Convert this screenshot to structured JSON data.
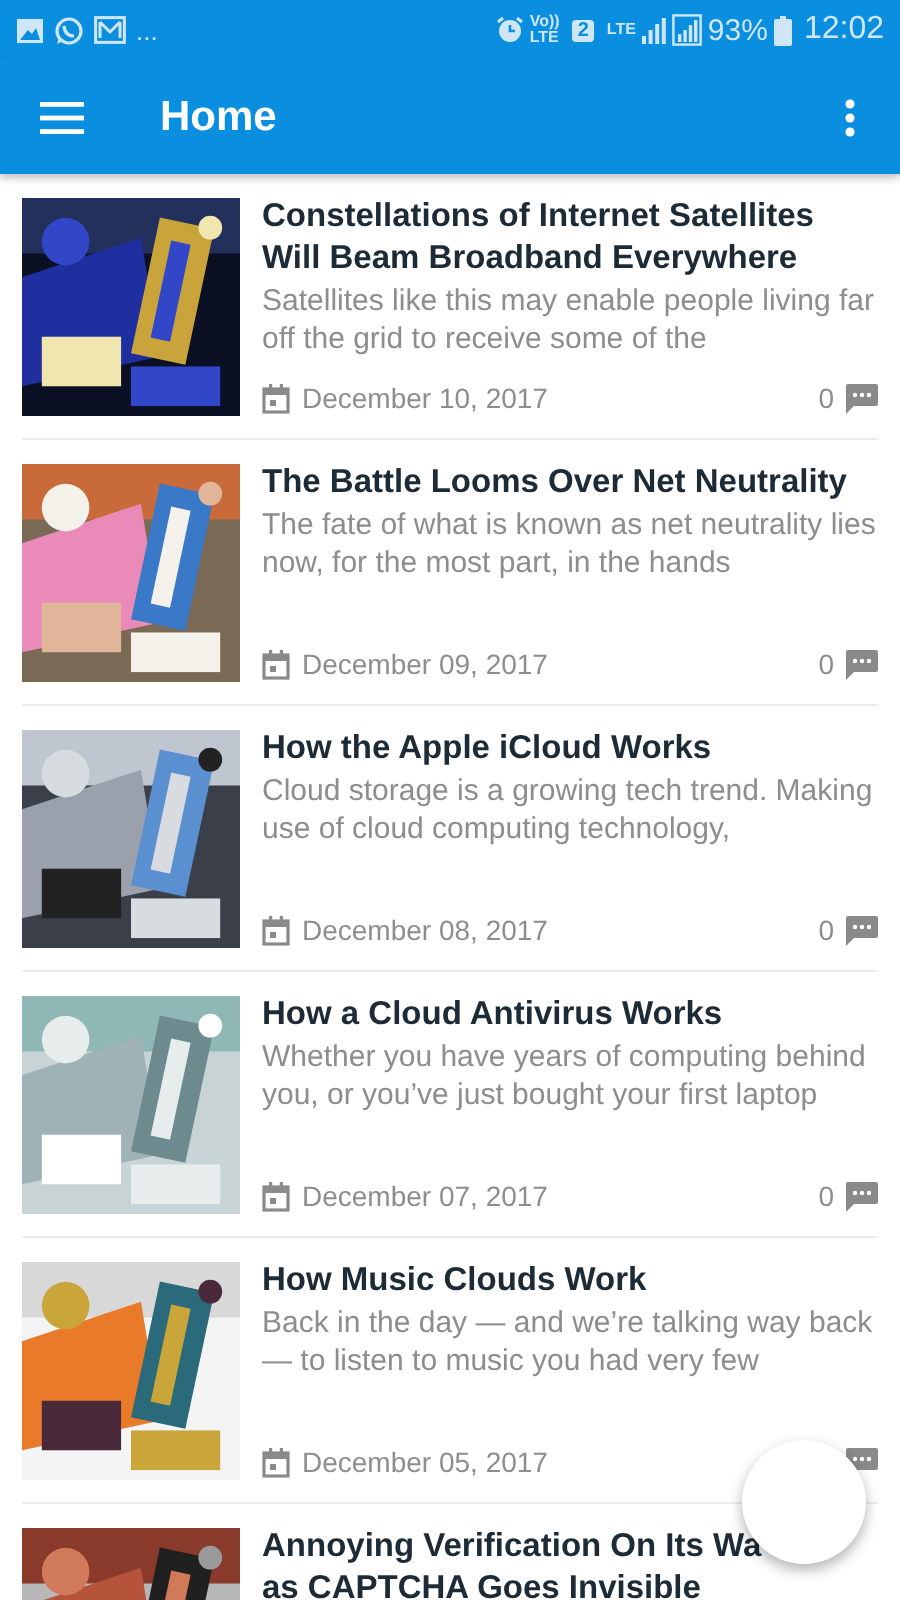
{
  "status_bar": {
    "overflow": "...",
    "volte_top": "Vo))",
    "volte_bottom": "LTE",
    "sim": "2",
    "network": "LTE",
    "battery": "93%",
    "time": "12:02"
  },
  "app_bar": {
    "title": "Home"
  },
  "articles": [
    {
      "title": "Constellations of Internet Satellites Will Beam Broadband Everywhere",
      "summary": "Satellites like this may enable people living far off the grid to receive some of the",
      "date": "December 10, 2017",
      "comments": "0"
    },
    {
      "title": "The Battle Looms Over Net Neutrality",
      "summary": "The fate of what is known as net neutrality lies now, for the most part, in the hands",
      "date": "December 09, 2017",
      "comments": "0"
    },
    {
      "title": "How the Apple iCloud Works",
      "summary": "Cloud storage is a growing tech trend. Making use of cloud computing technology,",
      "date": "December 08, 2017",
      "comments": "0"
    },
    {
      "title": "How a Cloud Antivirus Works",
      "summary": "Whether you have years of computing behind you, or you’ve just bought your first laptop",
      "date": "December 07, 2017",
      "comments": "0"
    },
    {
      "title": "How Music Clouds Work",
      "summary": "Back in the day — and we’re talking way back — to listen to music you had very few",
      "date": "December 05, 2017"
    },
    {
      "title": "Annoying Verification On Its Wa",
      "title_line2": "as CAPTCHA Goes Invisible"
    }
  ]
}
